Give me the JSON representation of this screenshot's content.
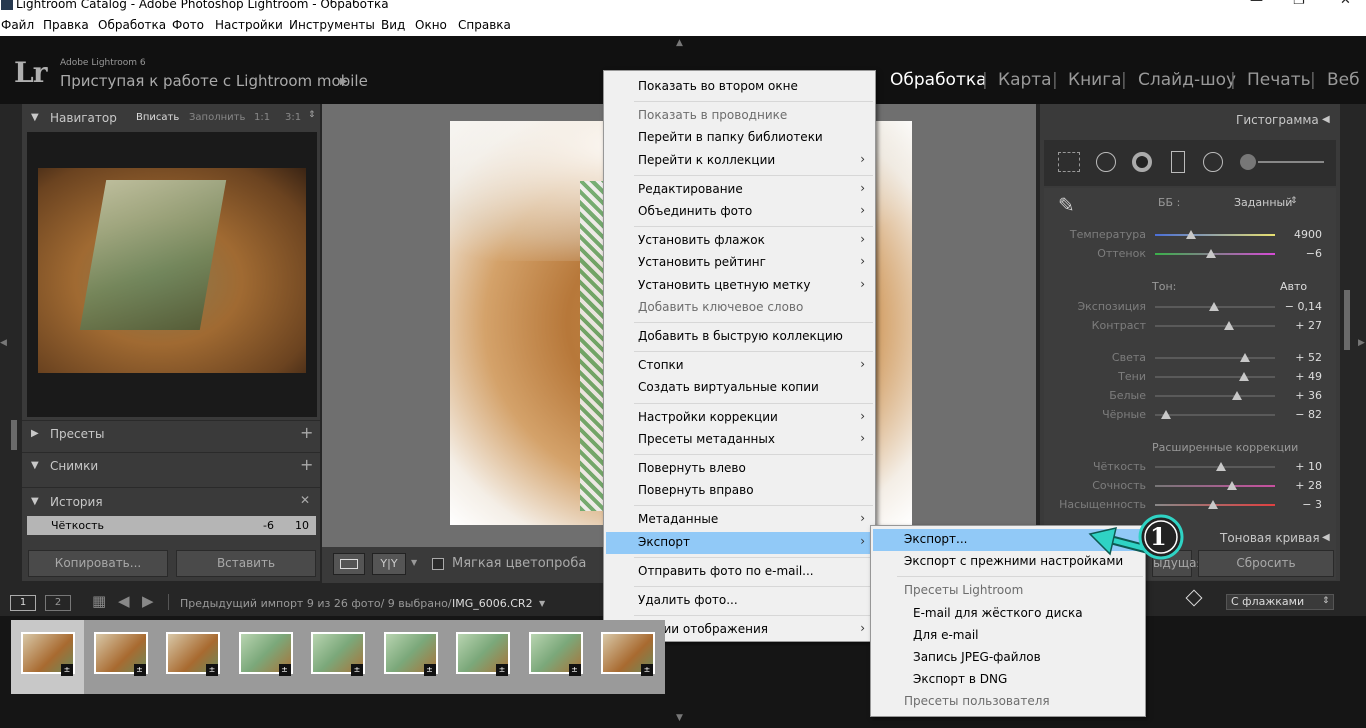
{
  "window": {
    "title": "Lightroom Catalog - Adobe Photoshop Lightroom - Обработка"
  },
  "menubar": [
    "Файл",
    "Правка",
    "Обработка",
    "Фото",
    "Настройки",
    "Инструменты",
    "Вид",
    "Окно",
    "Справка"
  ],
  "identity": {
    "product": "Adobe Lightroom 6",
    "message": "Приступая к работе с Lightroom mobile",
    "logo": "Lr"
  },
  "modules": [
    "Обработка",
    "Карта",
    "Книга",
    "Слайд-шоу",
    "Печать",
    "Веб"
  ],
  "navigator": {
    "title": "Навигатор",
    "fit": "Вписать",
    "fill": "Заполнить",
    "r11": "1:1",
    "r31": "3:1"
  },
  "left_panels": {
    "presets": "Пресеты",
    "snapshots": "Снимки",
    "history": "История"
  },
  "history_item": {
    "label": "Чёткость",
    "from": "-6",
    "to": "10"
  },
  "left_buttons": {
    "copy": "Копировать...",
    "paste": "Вставить"
  },
  "toolbar": {
    "softproof": "Мягкая цветопроба",
    "yy": "Y|Y"
  },
  "right": {
    "histogram": "Гистограмма",
    "wb_label": "ББ :",
    "wb_value": "Заданный",
    "temp": {
      "label": "Температура",
      "value": "4900",
      "pos": 0.3
    },
    "tint": {
      "label": "Оттенок",
      "value": "−6",
      "pos": 0.47
    },
    "tone_label": "Тон:",
    "auto": "Авто",
    "tone": [
      {
        "label": "Экспозиция",
        "value": "− 0,14",
        "pos": 0.49
      },
      {
        "label": "Контраст",
        "value": "+ 27",
        "pos": 0.62
      }
    ],
    "tone2": [
      {
        "label": "Света",
        "value": "+ 52",
        "pos": 0.75
      },
      {
        "label": "Тени",
        "value": "+ 49",
        "pos": 0.74
      },
      {
        "label": "Белые",
        "value": "+ 36",
        "pos": 0.68
      },
      {
        "label": "Чёрные",
        "value": "− 82",
        "pos": 0.09
      }
    ],
    "presence_label": "Расширенные коррекции",
    "presence": [
      {
        "label": "Чёткость",
        "value": "+ 10",
        "pos": 0.55
      },
      {
        "label": "Сочность",
        "value": "+ 28",
        "pos": 0.64
      },
      {
        "label": "Насыщенность",
        "value": "− 3",
        "pos": 0.48
      }
    ],
    "tonecurve": "Тоновая кривая",
    "reset": "Сбросить",
    "prev": "ыдущая"
  },
  "filmstrip": {
    "src": "Предыдущий импорт  9 из 26 фото/ 9 выбрано/",
    "file": "IMG_6006.CR2",
    "filter": "С флажками",
    "p1": "1",
    "p2": "2"
  },
  "menu": [
    {
      "label": "Показать во втором окне"
    },
    {
      "sep": true
    },
    {
      "label": "Показать в проводнике",
      "disabled": true
    },
    {
      "label": "Перейти в папку библиотеки"
    },
    {
      "label": "Перейти к коллекции",
      "sub": true
    },
    {
      "sep": true
    },
    {
      "label": "Редактирование",
      "sub": true
    },
    {
      "label": "Объединить фото",
      "sub": true
    },
    {
      "sep": true
    },
    {
      "label": "Установить флажок",
      "sub": true
    },
    {
      "label": "Установить рейтинг",
      "sub": true
    },
    {
      "label": "Установить цветную метку",
      "sub": true
    },
    {
      "label": "Добавить ключевое слово",
      "disabled": true
    },
    {
      "sep": true
    },
    {
      "label": "Добавить в быструю коллекцию"
    },
    {
      "sep": true
    },
    {
      "label": "Стопки",
      "sub": true
    },
    {
      "label": "Создать виртуальные копии"
    },
    {
      "sep": true
    },
    {
      "label": "Настройки коррекции",
      "sub": true
    },
    {
      "label": "Пресеты метаданных",
      "sub": true
    },
    {
      "sep": true
    },
    {
      "label": "Повернуть влево"
    },
    {
      "label": "Повернуть вправо"
    },
    {
      "sep": true
    },
    {
      "label": "Метаданные",
      "sub": true
    },
    {
      "label": "Экспорт",
      "sub": true,
      "highlight": true
    },
    {
      "sep": true
    },
    {
      "label": "Отправить фото по e-mail..."
    },
    {
      "sep": true
    },
    {
      "label": "Удалить фото..."
    },
    {
      "sep": true
    },
    {
      "label": "Опции отображения",
      "sub": true
    }
  ],
  "submenu": [
    {
      "label": "Экспорт...",
      "highlight": true
    },
    {
      "label": "Экспорт с прежними настройками"
    },
    {
      "sep": true
    },
    {
      "label": "Пресеты Lightroom",
      "disabled": true,
      "header": true
    },
    {
      "label": "E-mail для жёсткого диска",
      "indent": true
    },
    {
      "label": "Для e-mail",
      "indent": true
    },
    {
      "label": "Запись JPEG-файлов",
      "indent": true
    },
    {
      "label": "Экспорт в DNG",
      "indent": true
    },
    {
      "label": "Пресеты пользователя",
      "disabled": true,
      "header": true
    }
  ],
  "callout": {
    "number": "1",
    "color": "#2fd3c4"
  }
}
